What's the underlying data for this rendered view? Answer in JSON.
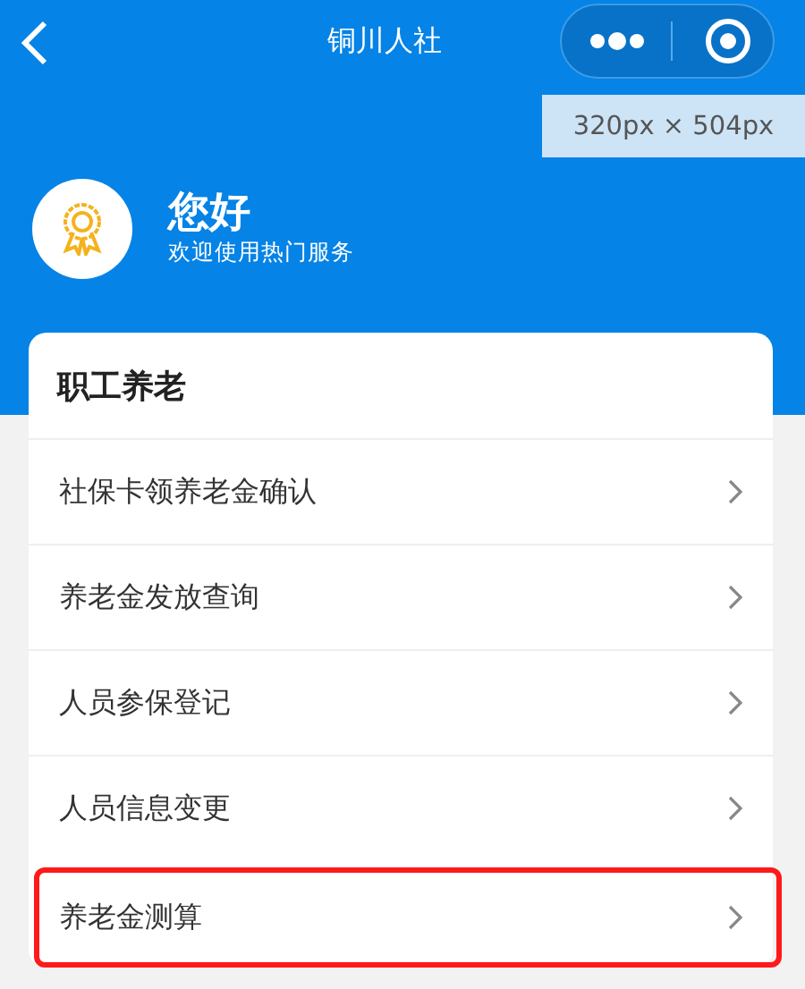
{
  "nav_bar": {
    "title": "铜川人社"
  },
  "size_tooltip": "320px × 504px",
  "greeting": {
    "title": "您好",
    "subtitle": "欢迎使用热门服务"
  },
  "card": {
    "title": "职工养老",
    "items": [
      {
        "label": "社保卡领养老金确认",
        "highlighted": false
      },
      {
        "label": "养老金发放查询",
        "highlighted": false
      },
      {
        "label": "人员参保登记",
        "highlighted": false
      },
      {
        "label": "人员信息变更",
        "highlighted": false
      },
      {
        "label": "养老金测算",
        "highlighted": true
      }
    ]
  }
}
